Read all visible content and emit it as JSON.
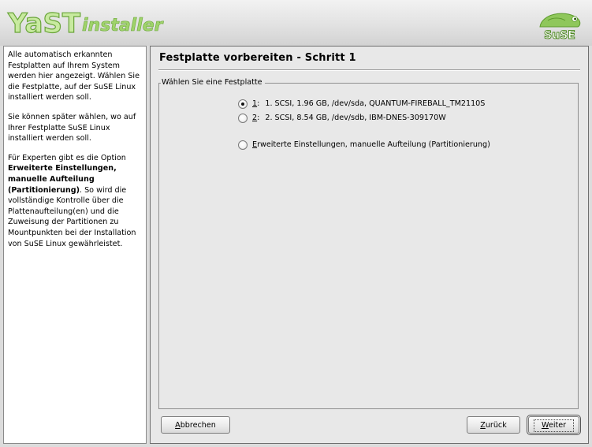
{
  "header": {
    "logo_text": "YaST installer",
    "brand_text": "SuSE",
    "colors": {
      "logo_green": "#8ac43f",
      "logo_outline": "#4f8a1f"
    }
  },
  "help": {
    "p1": "Alle automatisch erkannten Festplatten auf Ihrem System werden hier angezeigt. Wählen Sie die Festplatte, auf der SuSE Linux installiert werden soll.",
    "p2": "Sie können später wählen, wo auf Ihrer Festplatte SuSE Linux installiert werden soll.",
    "p3_pre": "Für Experten gibt es die Option ",
    "p3_bold": "Erweiterte Einstellungen, manuelle Aufteilung (Partitionierung)",
    "p3_post": ". So wird die vollständige Kontrolle über die Plattenaufteilung(en) und die Zuweisung der Partitionen zu Mountpunkten bei der Installation von SuSE Linux gewährleistet."
  },
  "main": {
    "title": "Festplatte vorbereiten - Schritt 1",
    "group_label": "Wählen Sie eine Festplatte",
    "options": [
      {
        "key": "1",
        "suffix": ":",
        "label": "1. SCSI, 1.96 GB, /dev/sda, QUANTUM-FIREBALL_TM2110S",
        "checked": true
      },
      {
        "key": "2",
        "suffix": ":",
        "label": "2. SCSI, 8.54 GB, /dev/sdb, IBM-DNES-309170W",
        "checked": false
      }
    ],
    "expert_option": {
      "mnemonic": "E",
      "rest": "rweiterte Einstellungen, manuelle Aufteilung (Partitionierung)",
      "checked": false
    }
  },
  "buttons": {
    "abort": {
      "mnemonic": "A",
      "rest": "bbrechen"
    },
    "back": {
      "mnemonic": "Z",
      "rest": "urück"
    },
    "next": {
      "mnemonic": "W",
      "rest": "eiter"
    }
  }
}
